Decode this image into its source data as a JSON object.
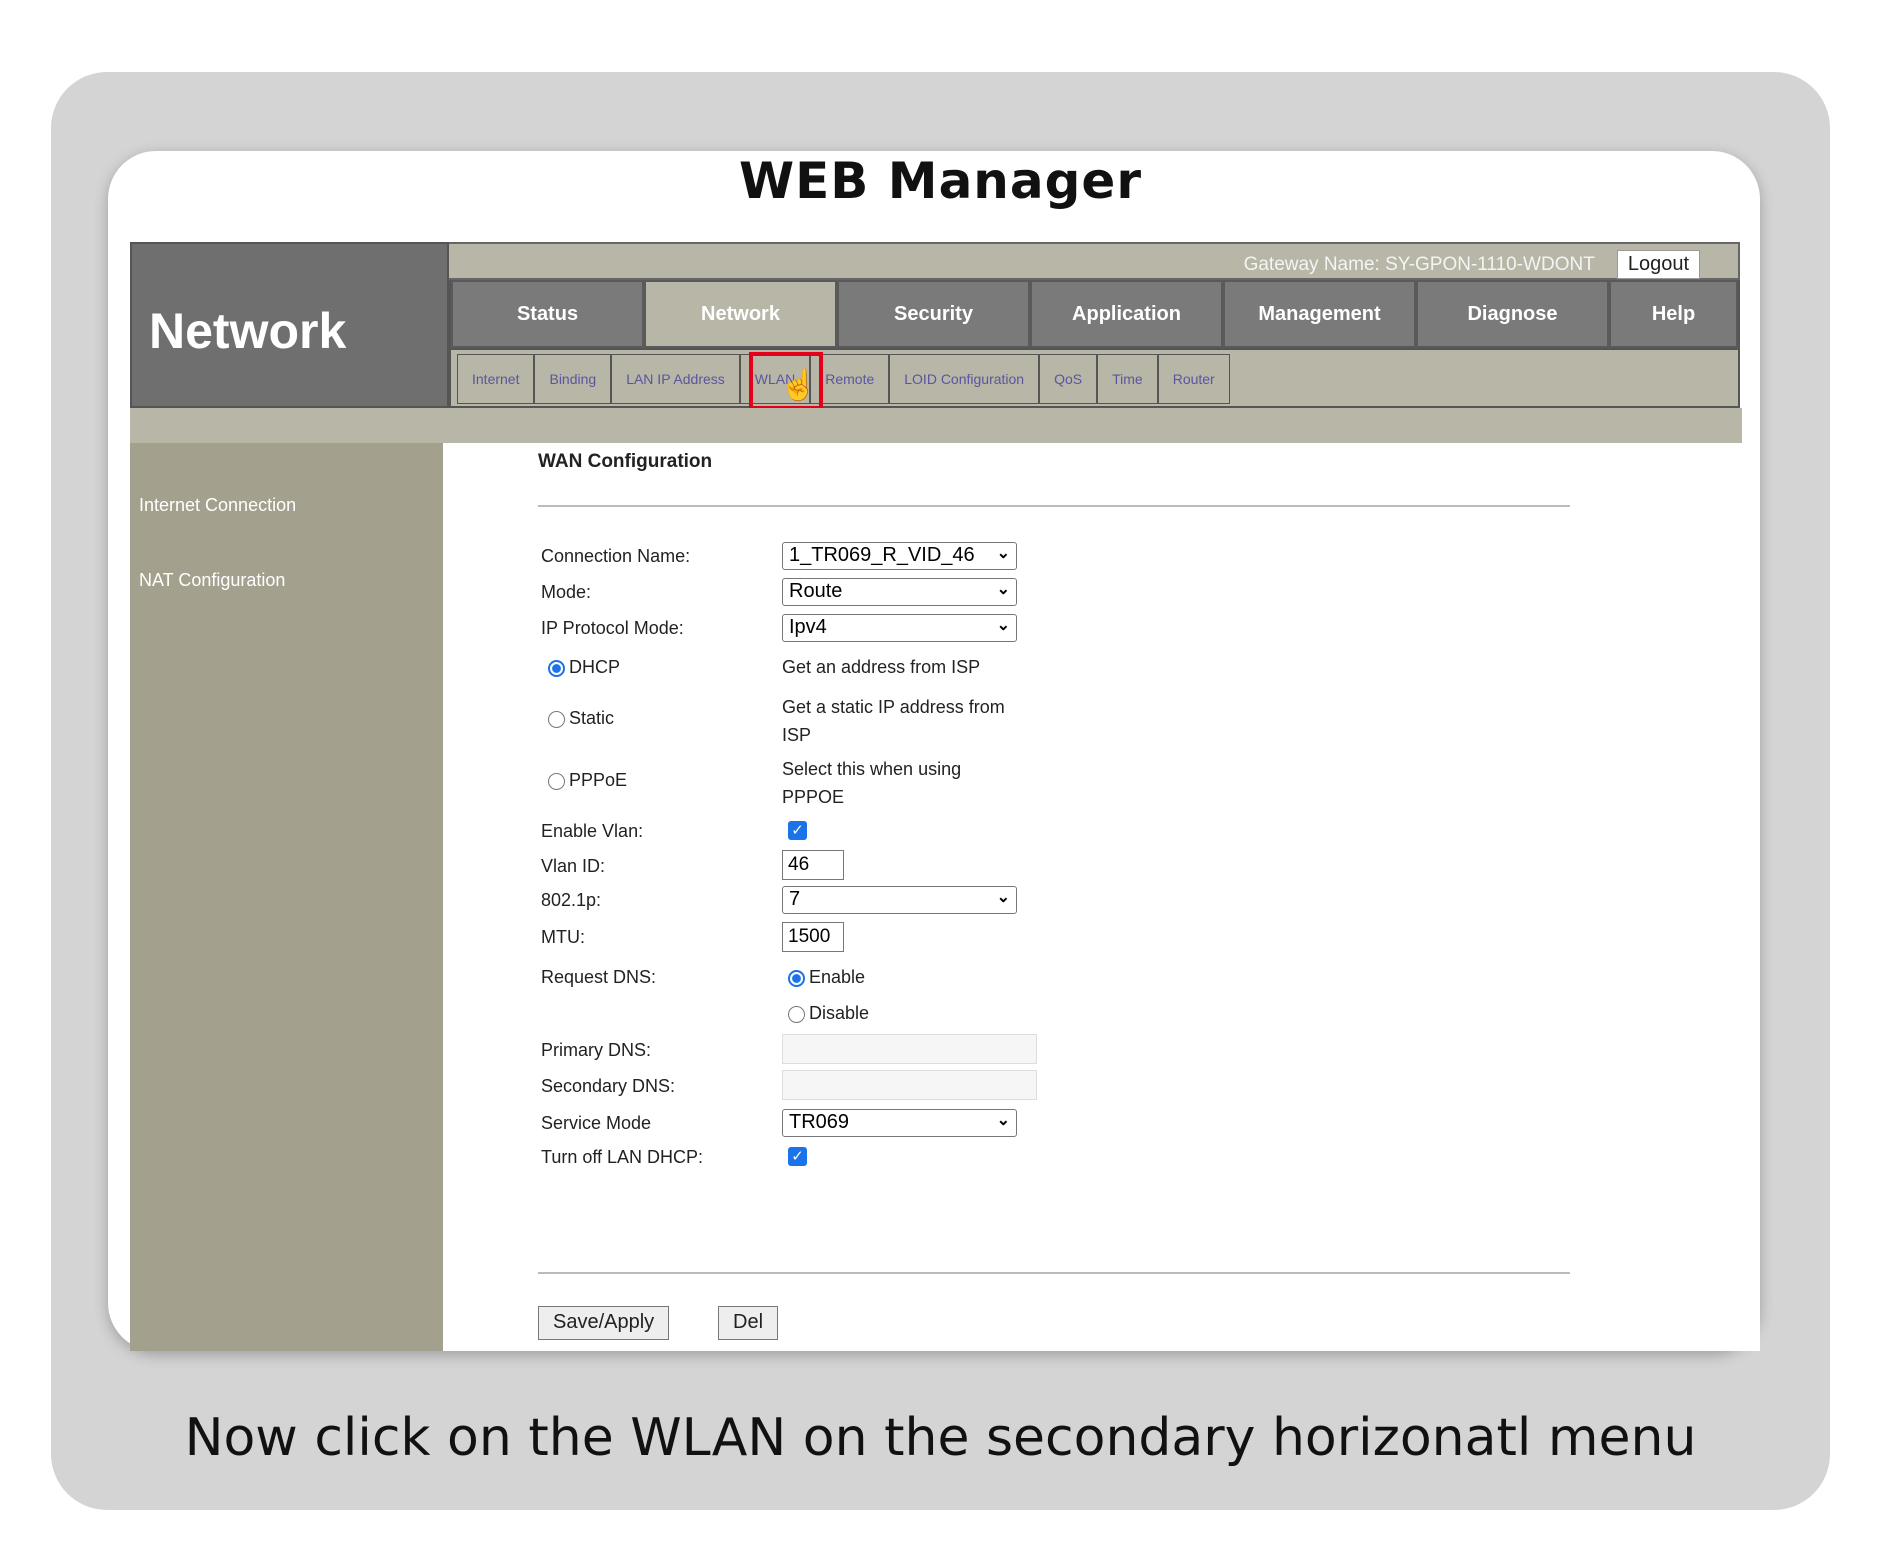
{
  "page": {
    "title": "WEB  Manager",
    "caption": "Now click on the WLAN on the secondary horizonatl menu"
  },
  "header": {
    "brand": "Network",
    "gateway": "Gateway Name: SY-GPON-1110-WDONT",
    "logout": "Logout"
  },
  "nav": {
    "tabs": [
      "Status",
      "Network",
      "Security",
      "Application",
      "Management",
      "Diagnose",
      "Help"
    ],
    "active": "Network"
  },
  "subnav": {
    "items": [
      "Internet",
      "Binding",
      "LAN IP Address",
      "WLAN",
      "Remote",
      "LOID Configuration",
      "QoS",
      "Time",
      "Router"
    ],
    "highlighted": "WLAN",
    "highlight_color": "#e2001a"
  },
  "sidebar": {
    "items": [
      "Internet Connection",
      "NAT Configuration"
    ]
  },
  "form": {
    "heading": "WAN Configuration",
    "connection_name": {
      "label": "Connection Name:",
      "value": "1_TR069_R_VID_46"
    },
    "mode": {
      "label": "Mode:",
      "value": "Route"
    },
    "ip_protocol": {
      "label": "IP Protocol Mode:",
      "value": "Ipv4"
    },
    "dhcp": {
      "label": "DHCP",
      "desc": "Get an address from ISP",
      "checked": true
    },
    "static": {
      "label": "Static",
      "desc": "Get a static IP address from ISP",
      "checked": false
    },
    "pppoe": {
      "label": "PPPoE",
      "desc": "Select this when using PPPOE",
      "checked": false
    },
    "enable_vlan": {
      "label": "Enable Vlan:",
      "checked": true
    },
    "vlan_id": {
      "label": "Vlan ID:",
      "value": "46"
    },
    "p8021": {
      "label": "802.1p:",
      "value": "7"
    },
    "mtu": {
      "label": "MTU:",
      "value": "1500"
    },
    "request_dns": {
      "label": "Request DNS:",
      "enable": "Enable",
      "disable": "Disable",
      "selected": "Enable"
    },
    "primary_dns": {
      "label": "Primary DNS:",
      "value": ""
    },
    "secondary_dns": {
      "label": "Secondary DNS:",
      "value": ""
    },
    "service_mode": {
      "label": "Service Mode",
      "value": "TR069"
    },
    "turn_off_dhcp": {
      "label": "Turn off LAN DHCP:",
      "checked": true
    },
    "save": "Save/Apply",
    "del": "Del"
  },
  "colors": {
    "accent": "#1a73e8",
    "nav_bg": "#777777",
    "tan": "#b8b6a6",
    "sidebar": "#a3a08e"
  }
}
